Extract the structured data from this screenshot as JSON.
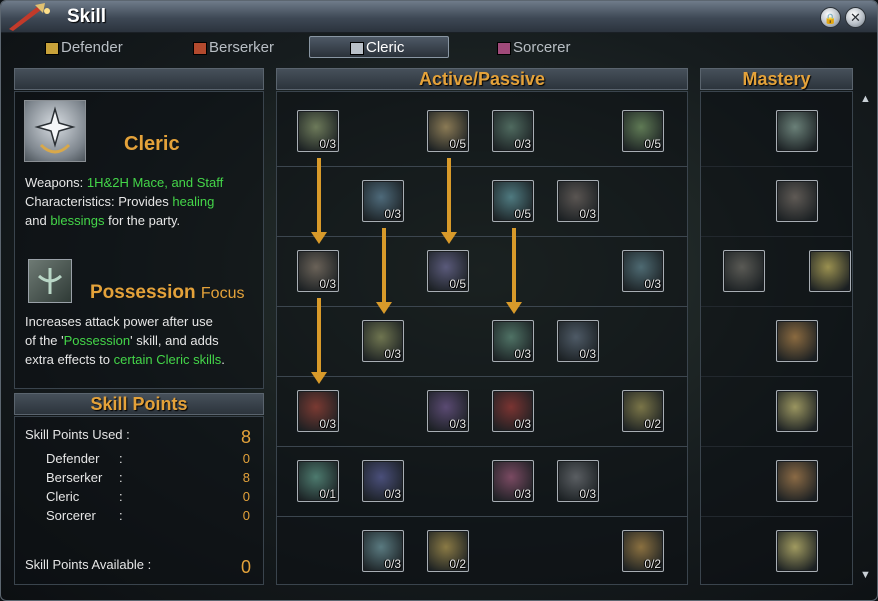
{
  "window": {
    "title": "Skill",
    "lock_label": "🔒",
    "close_label": "✕"
  },
  "tabs": [
    {
      "label": "Defender",
      "color": "#c8a23a",
      "active": false
    },
    {
      "label": "Berserker",
      "color": "#b34a2e",
      "active": false
    },
    {
      "label": "Cleric",
      "color": "#b9c0c8",
      "active": true
    },
    {
      "label": "Sorcerer",
      "color": "#a04a7a",
      "active": false
    }
  ],
  "headers": {
    "active_passive": "Active/Passive",
    "mastery": "Mastery",
    "skill_points": "Skill Points"
  },
  "class_info": {
    "name": "Cleric",
    "weapons_prefix": "Weapons: ",
    "weapons_value": "1H&2H Mace, and Staff",
    "char_prefix": "Characteristics: Provides ",
    "char_healing": "healing",
    "char_and": "and ",
    "char_blessings": "blessings",
    "char_suffix": " for the party."
  },
  "focus": {
    "name": "Possession",
    "suffix": "Focus",
    "line1": "Increases attack power after use",
    "line2_prefix": "of the '",
    "line2_skill": "Possession",
    "line2_suffix": "' skill, and adds",
    "line3_prefix": "extra effects to ",
    "line3_link": "certain Cleric skills",
    "line3_suffix": "."
  },
  "skill_points": {
    "used_label": "Skill Points Used :",
    "used_value": "8",
    "breakdown": [
      {
        "label": "Defender",
        "sep": ":",
        "value": "0"
      },
      {
        "label": "Berserker",
        "sep": ":",
        "value": "8"
      },
      {
        "label": "Cleric",
        "sep": ":",
        "value": "0"
      },
      {
        "label": "Sorcerer",
        "sep": ":",
        "value": "0"
      }
    ],
    "available_label": "Skill Points Available :",
    "available_value": "0"
  },
  "skill_rows": [
    [
      {
        "col": 0,
        "count": "0/3",
        "color": "#6d7a5a"
      },
      {
        "col": 2,
        "count": "0/5",
        "color": "#8a7a55"
      },
      {
        "col": 3,
        "count": "0/3",
        "color": "#4f6a5f"
      },
      {
        "col": 5,
        "count": "0/5",
        "color": "#5f7a55"
      }
    ],
    [
      {
        "col": 1,
        "count": "0/3",
        "color": "#4e6a7a"
      },
      {
        "col": 3,
        "count": "0/5",
        "color": "#4f7a80"
      },
      {
        "col": 4,
        "count": "0/3",
        "color": "#5a5552"
      }
    ],
    [
      {
        "col": 0,
        "count": "0/3",
        "color": "#6a6258"
      },
      {
        "col": 2,
        "count": "0/5",
        "color": "#5a5a7a"
      },
      {
        "col": 5,
        "count": "0/3",
        "color": "#4e6a72"
      }
    ],
    [
      {
        "col": 1,
        "count": "0/3",
        "color": "#6f7550"
      },
      {
        "col": 3,
        "count": "0/3",
        "color": "#4f7265"
      },
      {
        "col": 4,
        "count": "0/3",
        "color": "#4e5a66"
      }
    ],
    [
      {
        "col": 0,
        "count": "0/3",
        "color": "#7a3a32"
      },
      {
        "col": 2,
        "count": "0/3",
        "color": "#5a4a72"
      },
      {
        "col": 3,
        "count": "0/3",
        "color": "#7a3432"
      },
      {
        "col": 5,
        "count": "0/2",
        "color": "#7a7548"
      }
    ],
    [
      {
        "col": 0,
        "count": "0/1",
        "color": "#4d7a6e"
      },
      {
        "col": 1,
        "count": "0/3",
        "color": "#4a4f7a"
      },
      {
        "col": 3,
        "count": "0/3",
        "color": "#7a4a62"
      },
      {
        "col": 4,
        "count": "0/3",
        "color": "#5a5e62"
      }
    ],
    [
      {
        "col": 1,
        "count": "0/3",
        "color": "#5a7a80"
      },
      {
        "col": 2,
        "count": "0/2",
        "color": "#8a7a45"
      },
      {
        "col": 5,
        "count": "0/2",
        "color": "#8a7040"
      }
    ]
  ],
  "mastery_rows": [
    [
      {
        "col": 1,
        "color": "#6a8078"
      }
    ],
    [
      {
        "col": 1,
        "color": "#5f5a55"
      }
    ],
    [
      {
        "col": 0,
        "color": "#5a5a55"
      },
      {
        "col": 2,
        "color": "#9a9050"
      }
    ],
    [
      {
        "col": 1,
        "color": "#8a6a40"
      }
    ],
    [
      {
        "col": 1,
        "color": "#9a9560"
      }
    ],
    [
      {
        "col": 1,
        "color": "#8a6a45"
      }
    ],
    [
      {
        "col": 1,
        "color": "#a09a60"
      }
    ]
  ],
  "scroll": {
    "up": "▲",
    "down": "▼"
  }
}
